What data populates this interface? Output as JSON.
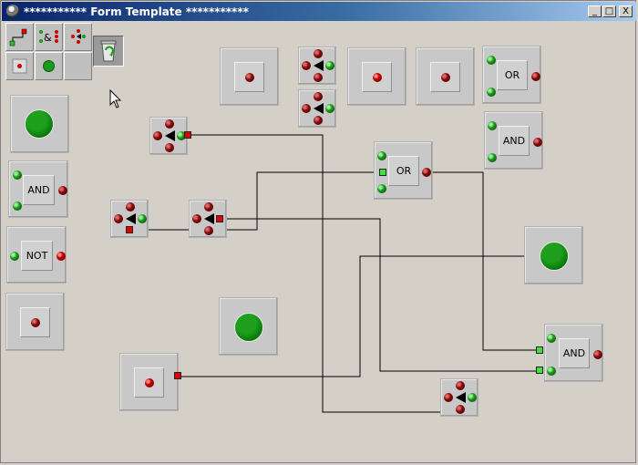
{
  "window": {
    "title": "*********** Form Template ***********",
    "controls": {
      "minimize": "_",
      "maximize": "□",
      "close": "X"
    }
  },
  "blocks": {
    "or_top": "OR",
    "and_top": "AND",
    "and_left": "AND",
    "not_left": "NOT",
    "or_mid": "OR",
    "and_right": "AND"
  },
  "palette": {
    "tools": [
      "wire-tool-icon",
      "logic-gate-tool-icon",
      "splitter-tool-icon",
      "recycle-bin-icon",
      "input-tool-icon",
      "lamp-tool-icon"
    ]
  },
  "colors": {
    "wire": "#000000",
    "output_port": "#e00000",
    "input_port": "#3ce43c",
    "lamp_on": "#0a7a0a"
  }
}
